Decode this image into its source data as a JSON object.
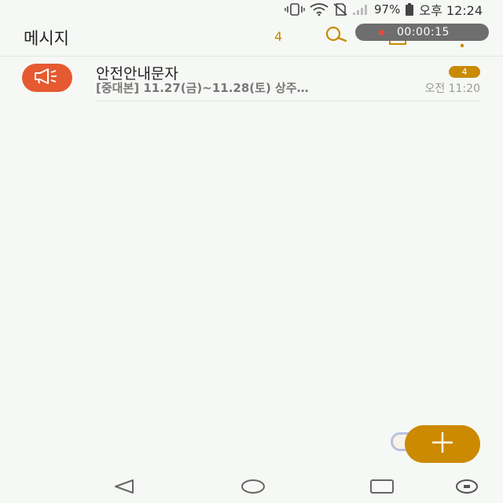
{
  "status_bar": {
    "battery": "97%",
    "time": "오후 12:24",
    "icons": [
      "vibrate-icon",
      "wifi-icon",
      "no-sim-icon",
      "signal-icon",
      "battery-icon"
    ]
  },
  "app_bar": {
    "title": "메시지",
    "unread_count": "4",
    "icons": [
      "search-icon",
      "edit-icon",
      "more-icon"
    ]
  },
  "screen_recorder": {
    "elapsed": "00:00:15"
  },
  "conversations": [
    {
      "name": "안전안내문자",
      "preview": "[중대본] 11.27(금)~11.28(토) 상주…",
      "time": "오전 11:20",
      "unread": "4",
      "avatar_icon": "megaphone-icon"
    }
  ],
  "fab": {
    "icon": "plus-icon"
  },
  "nav_bar": {
    "icons": [
      "back-icon",
      "home-icon",
      "recents-icon",
      "notification-icon"
    ]
  },
  "colors": {
    "background": "#f6f8f5",
    "accent": "#cc8a00",
    "avatar": "#e65a31",
    "recorder": "#6e6e6e"
  }
}
